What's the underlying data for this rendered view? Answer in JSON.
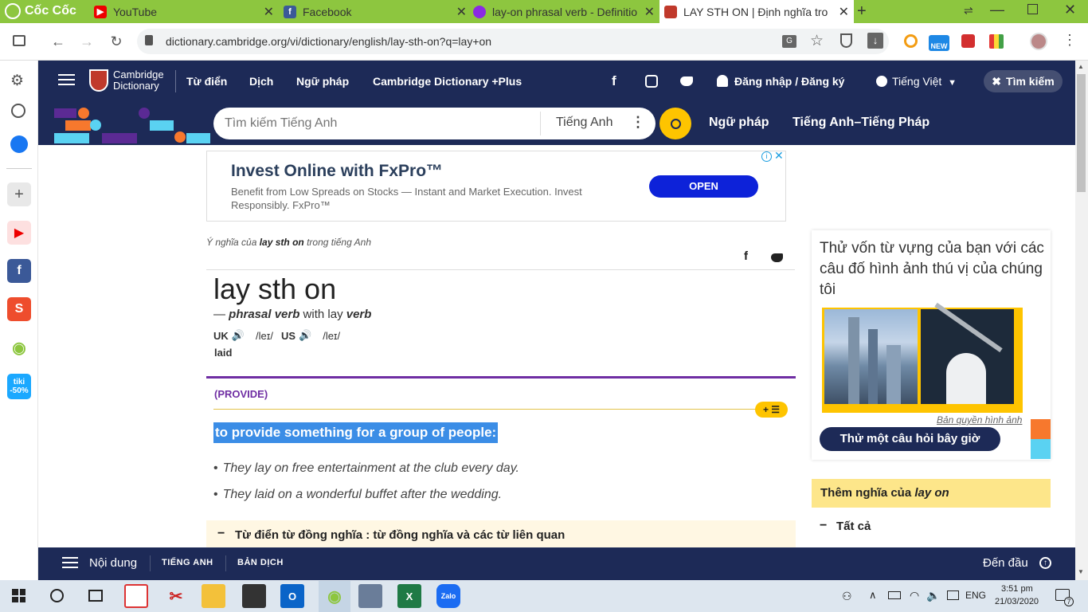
{
  "browser": {
    "brand": "Cốc Cốc",
    "tabs": [
      {
        "title": "YouTube"
      },
      {
        "title": "Facebook"
      },
      {
        "title": "lay-on phrasal verb - Definitio"
      },
      {
        "title": "LAY STH ON | Định nghĩa tron"
      }
    ],
    "new_tab": "+",
    "url": "dictionary.cambridge.org/vi/dictionary/english/lay-sth-on?q=lay+on"
  },
  "site": {
    "logo_line1": "Cambridge",
    "logo_line2": "Dictionary",
    "nav": [
      "Từ điển",
      "Dịch",
      "Ngữ pháp",
      "Cambridge Dictionary +Plus"
    ],
    "login": "Đăng nhập / Đăng ký",
    "language": "Tiếng Việt",
    "search_button": "Tìm kiếm",
    "search_placeholder": "Tìm kiếm Tiếng Anh",
    "search_lang": "Tiếng Anh",
    "sub_nav": [
      "Ngữ pháp",
      "Tiếng Anh–Tiếng Pháp"
    ]
  },
  "ad": {
    "title": "Invest Online with FxPro™",
    "body": "Benefit from Low Spreads on Stocks — Instant and Market Execution. Invest Responsibly. FxPro™",
    "cta": "OPEN"
  },
  "entry": {
    "meaning_prefix": "Ý nghĩa của ",
    "meaning_word": "lay sth on",
    "meaning_suffix": " trong tiếng Anh",
    "headword": "lay sth on",
    "dash": "— ",
    "pos": "phrasal verb",
    "with": " with lay ",
    "pos2": "verb",
    "uk": "UK",
    "uk_ipa": "/leɪ/",
    "us": "US",
    "us_ipa": "/leɪ/",
    "past": "laid",
    "guideword": "(PROVIDE)",
    "definition": "to provide something for a group of people:",
    "examples": [
      "They lay on free entertainment at the club every day.",
      "They laid on a wonderful buffet after the wedding."
    ],
    "thesaurus": "Từ điển từ đồng nghĩa : từ đồng nghĩa và các từ liên quan"
  },
  "sidebar": {
    "quiz_title": "Thử vốn từ vựng của bạn với các câu đố hình ảnh thú vị của chúng tôi",
    "copyright": "Bản quyền hình ảnh",
    "quiz_button": "Thử một câu hỏi bây giờ",
    "more_prefix": "Thêm nghĩa của ",
    "more_word": "lay on",
    "all": "Tất cả"
  },
  "bottom": {
    "contents": "Nội dung",
    "tab1": "TIẾNG ANH",
    "tab2": "BẢN DỊCH",
    "top": "Đến đầu"
  },
  "taskbar": {
    "lang": "ENG",
    "time": "3:51 pm",
    "date": "21/03/2020",
    "notif": "7"
  },
  "colors": {
    "brand_green": "#8dc63f",
    "cd_navy": "#1d2a57",
    "ad_blue": "#0d22d9",
    "guide_purple": "#6f2ea3",
    "highlight": "#3b8de6",
    "sidebar_yellow": "#fde68a"
  }
}
